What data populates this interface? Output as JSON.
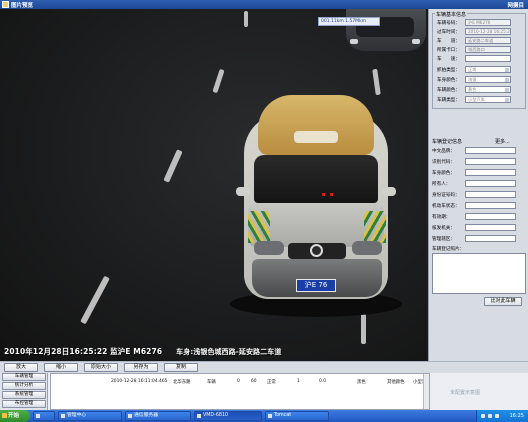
{
  "window": {
    "title": "图片预览",
    "right_title": "网摄目"
  },
  "video": {
    "speed_label": "001.11km   1.57Mkm",
    "overlay_left": "2010年12月28日16:25:22 监沪E M6276",
    "overlay_right": "车身:浅银色城西路-延安路二车道",
    "plate": "沪E 76"
  },
  "panel": {
    "section1_title": "车辆基本信息",
    "fields": [
      {
        "label": "车辆号码：",
        "value": "沪E M6276"
      },
      {
        "label": "过车时间：",
        "value": "2010-12-28 16:25:22"
      },
      {
        "label": "车　　道：",
        "value": "延安路二车道"
      },
      {
        "label": "所属卡口：",
        "value": "城西路口"
      },
      {
        "label": "车　　速：",
        "value": ""
      },
      {
        "label": "抓拍类型：",
        "value": "正常"
      },
      {
        "label": "车身颜色：",
        "value": "浅银"
      },
      {
        "label": "车辆颜色：",
        "value": "黄色"
      },
      {
        "label": "车辆类型：",
        "value": "小型汽车"
      }
    ],
    "section2_title": "车辆登记信息",
    "more_label": "更多...",
    "reg_fields": [
      {
        "label": "中文品牌："
      },
      {
        "label": "识别代码："
      },
      {
        "label": "车身颜色："
      },
      {
        "label": "所有人："
      },
      {
        "label": "身份证号码："
      },
      {
        "label": "机动车状态："
      },
      {
        "label": "有效期："
      },
      {
        "label": "核发机关："
      },
      {
        "label": "管理辖区："
      }
    ],
    "photo_label": "车辆登记照片：",
    "compare_button": "比对此车辆"
  },
  "toolbar": {
    "buttons": [
      "放大",
      "缩小",
      "原始大小",
      "另存为",
      "复制"
    ]
  },
  "nav": {
    "items": [
      "车辆管理",
      "统计分析",
      "系统管理",
      "布控管理"
    ]
  },
  "list": {
    "cells": [
      "2010-12-28 16:11:04.465",
      "北华东路",
      "车辆",
      "0",
      "60",
      "正常",
      "1",
      "0.0",
      "黑色",
      "其他颜色",
      "小型汽"
    ]
  },
  "tip": {
    "text": "未配置示意图"
  },
  "taskbar": {
    "start": "开始",
    "tasks": [
      "",
      "管理中心",
      "通信服务器",
      "VMD-6810",
      "Tomcat"
    ],
    "clock": "16:25"
  }
}
